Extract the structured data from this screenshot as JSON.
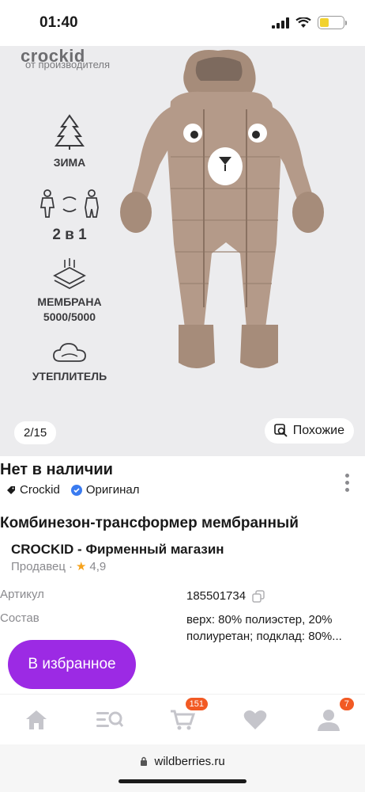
{
  "status": {
    "time": "01:40"
  },
  "gallery": {
    "brand_logo": "crockid",
    "brand_sub": "от производителя",
    "features": [
      {
        "label": "ЗИМА",
        "icon": "tree-icon"
      },
      {
        "label": "2 в 1",
        "icon": "transform-icon"
      },
      {
        "label": "МЕМБРАНА\n5000/5000",
        "icon": "membrane-icon"
      },
      {
        "label": "УТЕПЛИТЕЛЬ",
        "icon": "cloud-icon"
      }
    ],
    "counter": "2/15",
    "similar_label": "Похожие"
  },
  "product": {
    "stock_status": "Нет в наличии",
    "brand": "Crockid",
    "original_label": "Оригинал",
    "name": "Комбинезон-трансформер мембранный",
    "seller": "CROCKID - Фирменный магазин",
    "seller_label": "Продавец",
    "rating": "4,9",
    "specs": [
      {
        "key": "Артикул",
        "value": "185501734"
      },
      {
        "key": "Состав",
        "value": "верх: 80% полиэстер, 20% полиуретан; подклад: 80%..."
      }
    ]
  },
  "actions": {
    "favorite_label": "В избранное"
  },
  "nav": {
    "items": [
      {
        "name": "home",
        "icon": "home-icon",
        "badge": ""
      },
      {
        "name": "catalog",
        "icon": "catalog-search-icon",
        "badge": ""
      },
      {
        "name": "cart",
        "icon": "cart-icon",
        "badge": "151"
      },
      {
        "name": "favorites",
        "icon": "heart-icon",
        "badge": ""
      },
      {
        "name": "profile",
        "icon": "profile-icon",
        "badge": "7"
      }
    ]
  },
  "browser": {
    "url": "wildberries.ru"
  },
  "colors": {
    "accent": "#9c2ae4",
    "badge": "#f25a24",
    "star": "#f6a21b",
    "product": "#b49a89"
  }
}
